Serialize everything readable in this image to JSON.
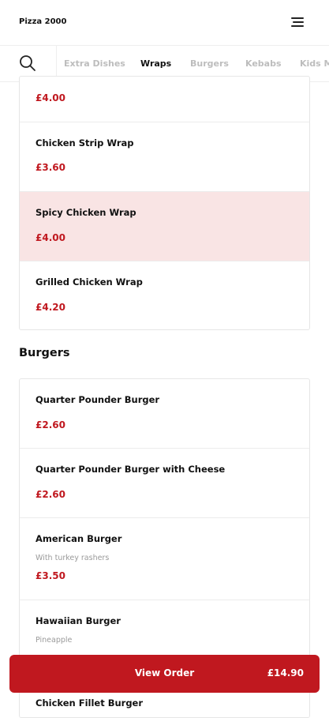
{
  "header": {
    "brand": "Pizza 2000",
    "menu_icon": "hamburger-menu-icon"
  },
  "tabs": {
    "search_icon": "search-icon",
    "items": [
      {
        "label": "Extra Dishes",
        "active": false
      },
      {
        "label": "Wraps",
        "active": true
      },
      {
        "label": "Burgers",
        "active": false
      },
      {
        "label": "Kebabs",
        "active": false
      },
      {
        "label": "Kids M",
        "active": false
      }
    ]
  },
  "wraps": {
    "items": [
      {
        "price": "£4.00"
      },
      {
        "name": "Chicken Strip Wrap",
        "price": "£3.60"
      },
      {
        "name": "Spicy Chicken Wrap",
        "price": "£4.00",
        "highlighted": true
      },
      {
        "name": "Grilled Chicken Wrap",
        "price": "£4.20"
      }
    ]
  },
  "burgers": {
    "title": "Burgers",
    "items": [
      {
        "name": "Quarter Pounder Burger",
        "price": "£2.60"
      },
      {
        "name": "Quarter Pounder Burger with Cheese",
        "price": "£2.60"
      },
      {
        "name": "American Burger",
        "description": "With turkey rashers",
        "price": "£3.50"
      },
      {
        "name": "Hawaiian Burger",
        "description": "Pineapple"
      },
      {
        "name": "Chicken Fillet Burger"
      }
    ]
  },
  "order": {
    "label": "View Order",
    "total": "£14.90"
  },
  "colors": {
    "accent": "#c0181f",
    "highlight": "#f9e4e4"
  }
}
